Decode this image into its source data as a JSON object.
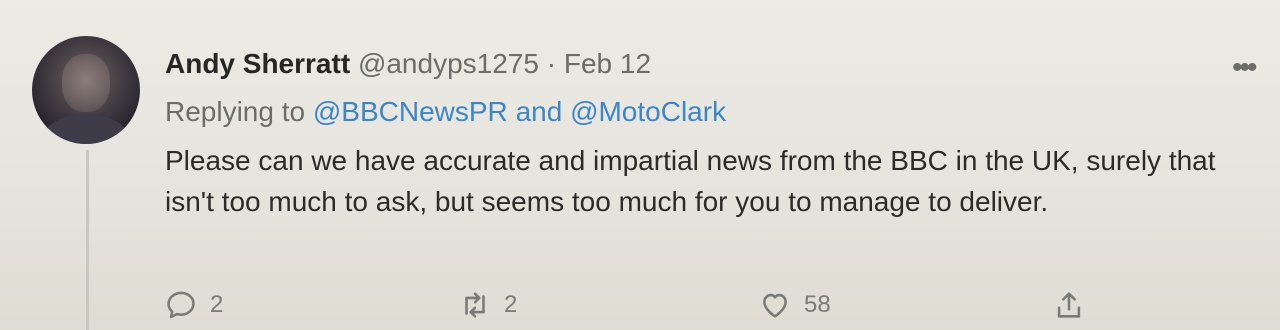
{
  "tweet": {
    "author_name": "Andy Sherratt",
    "handle": "@andyps1275",
    "separator": "·",
    "date": "Feb 12",
    "more_label": "•••",
    "replying_prefix": "Replying to",
    "mention_1": "@BBCNewsPR",
    "replying_and": "and",
    "mention_2": "@MotoClark",
    "text": "Please can we have accurate and impartial news from the BBC in the UK, surely that isn't too much to ask, but seems too much for you to manage to deliver.",
    "reply_count": "2",
    "retweet_count": "2",
    "like_count": "58"
  },
  "icons": {
    "reply": "reply-icon",
    "retweet": "retweet-icon",
    "like": "heart-icon",
    "share": "share-icon",
    "more": "more-icon"
  },
  "colors": {
    "mention": "#3c86c8",
    "muted": "#6c6c68",
    "background": "#e7e6df"
  }
}
